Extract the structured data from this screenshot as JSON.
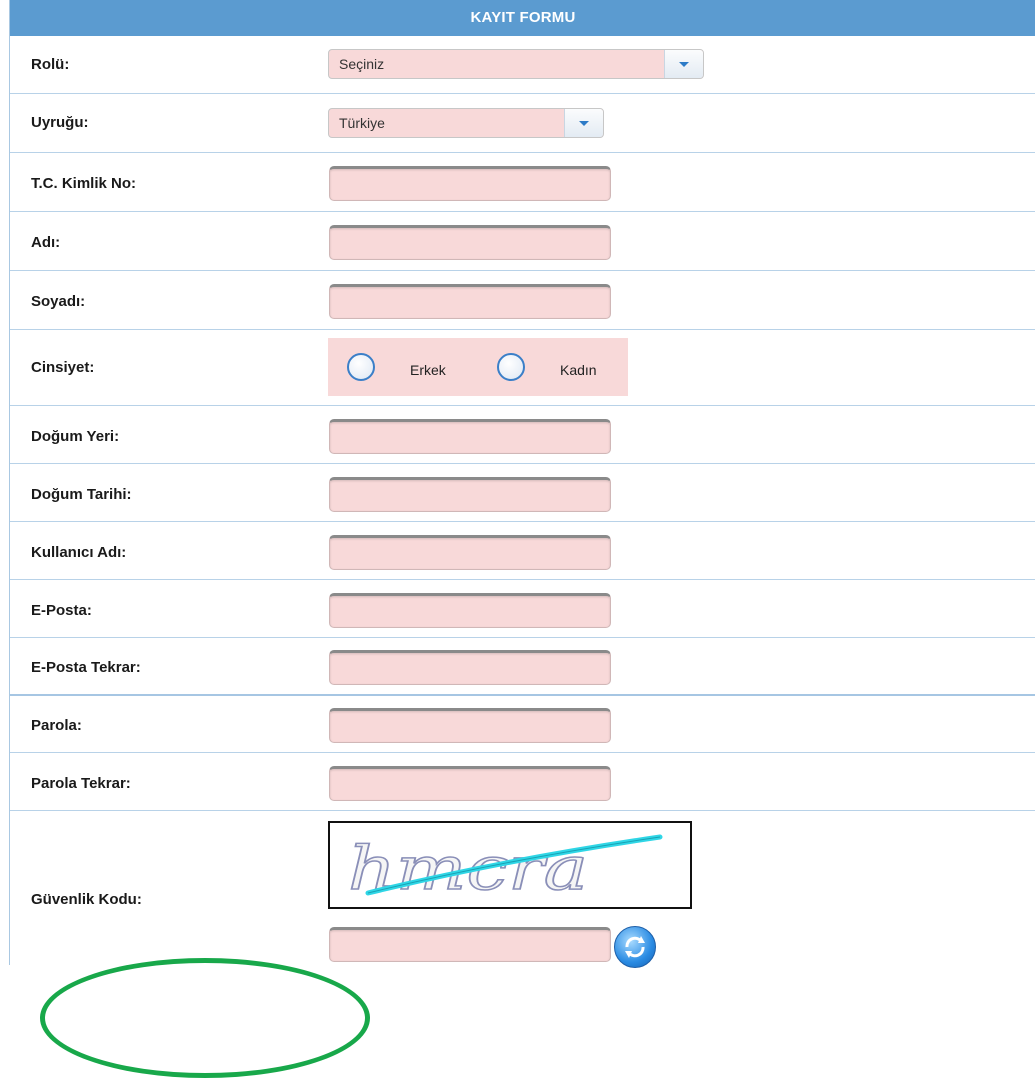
{
  "form": {
    "title": "KAYIT FORMU",
    "fields": {
      "role": {
        "label": "Rolü:",
        "value": "Seçiniz"
      },
      "nationality": {
        "label": "Uyruğu:",
        "value": "Türkiye"
      },
      "tc_id": {
        "label": "T.C. Kimlik No:",
        "value": ""
      },
      "first_name": {
        "label": "Adı:",
        "value": ""
      },
      "last_name": {
        "label": "Soyadı:",
        "value": ""
      },
      "gender": {
        "label": "Cinsiyet:",
        "options": [
          "Erkek",
          "Kadın"
        ]
      },
      "birth_place": {
        "label": "Doğum Yeri:",
        "value": ""
      },
      "birth_date": {
        "label": "Doğum Tarihi:",
        "value": ""
      },
      "username": {
        "label": "Kullanıcı Adı:",
        "value": ""
      },
      "email": {
        "label": "E-Posta:",
        "value": ""
      },
      "email_repeat": {
        "label": "E-Posta Tekrar:",
        "value": ""
      },
      "password": {
        "label": "Parola:",
        "value": ""
      },
      "password_repeat": {
        "label": "Parola Tekrar:",
        "value": ""
      },
      "security_code": {
        "label": "Güvenlik Kodu:",
        "captcha_text": "hmcra",
        "value": ""
      }
    }
  },
  "colors": {
    "header_bg": "#5b9bd0",
    "field_bg": "#f8d9d9",
    "row_border": "#b8d2e8",
    "annotation_arc": "#18a84a"
  },
  "icons": {
    "dropdown": "chevron-down-icon",
    "refresh": "refresh-icon"
  }
}
